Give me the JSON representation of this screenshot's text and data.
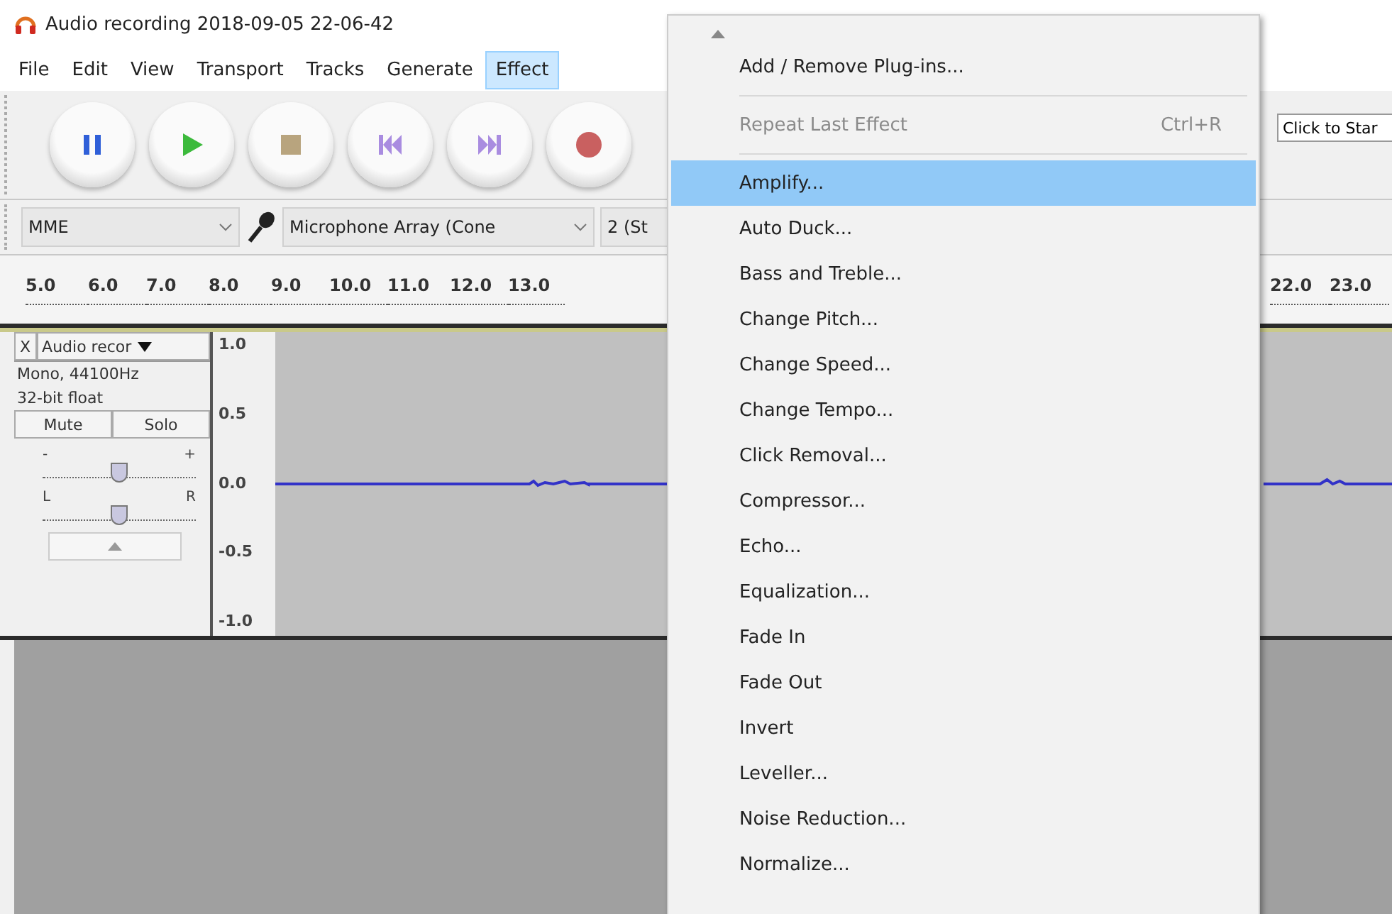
{
  "window": {
    "title": "Audio recording 2018-09-05 22-06-42"
  },
  "menu_bar": [
    {
      "label": "File",
      "selected": false
    },
    {
      "label": "Edit",
      "selected": false
    },
    {
      "label": "View",
      "selected": false
    },
    {
      "label": "Transport",
      "selected": false
    },
    {
      "label": "Tracks",
      "selected": false
    },
    {
      "label": "Generate",
      "selected": false
    },
    {
      "label": "Effect",
      "selected": true
    }
  ],
  "transport": [
    {
      "kind": "pause"
    },
    {
      "kind": "play"
    },
    {
      "kind": "stop"
    },
    {
      "kind": "skip_start"
    },
    {
      "kind": "skip_end"
    },
    {
      "kind": "record"
    }
  ],
  "device_toolbar": {
    "host": "MME",
    "input_device": "Microphone Array (Cone",
    "channels": "2 (St"
  },
  "ruler": {
    "left_labels": [
      "5.0",
      "6.0",
      "7.0",
      "8.0",
      "9.0",
      "10.0",
      "11.0",
      "12.0",
      "13.0"
    ],
    "right_labels": [
      "22.0",
      "23.0"
    ]
  },
  "selection_toolbar": {
    "button": "Click to Star"
  },
  "track": {
    "close": "X",
    "name": "Audio recor",
    "format": "Mono, 44100Hz",
    "sample_format": "32-bit float",
    "mute": "Mute",
    "solo": "Solo",
    "gain_minus": "-",
    "gain_plus": "+",
    "gain_slider": {
      "level": 0.5
    },
    "pan_left": "L",
    "pan_right": "R",
    "pan_slider": {
      "level": 0.5
    },
    "scale": [
      "1.0",
      "0.5",
      "0.0",
      "-0.5",
      "-1.0"
    ]
  },
  "effect_menu": [
    {
      "kind": "item",
      "label": "Add / Remove Plug-ins...",
      "disabled": false,
      "selected": false
    },
    {
      "kind": "separator"
    },
    {
      "kind": "item",
      "label": "Repeat Last Effect",
      "shortcut": "Ctrl+R",
      "disabled": true,
      "selected": false
    },
    {
      "kind": "separator"
    },
    {
      "kind": "item",
      "label": "Amplify...",
      "disabled": false,
      "selected": true
    },
    {
      "kind": "item",
      "label": "Auto Duck...",
      "disabled": false,
      "selected": false
    },
    {
      "kind": "item",
      "label": "Bass and Treble...",
      "disabled": false,
      "selected": false
    },
    {
      "kind": "item",
      "label": "Change Pitch...",
      "disabled": false,
      "selected": false
    },
    {
      "kind": "item",
      "label": "Change Speed...",
      "disabled": false,
      "selected": false
    },
    {
      "kind": "item",
      "label": "Change Tempo...",
      "disabled": false,
      "selected": false
    },
    {
      "kind": "item",
      "label": "Click Removal...",
      "disabled": false,
      "selected": false
    },
    {
      "kind": "item",
      "label": "Compressor...",
      "disabled": false,
      "selected": false
    },
    {
      "kind": "item",
      "label": "Echo...",
      "disabled": false,
      "selected": false
    },
    {
      "kind": "item",
      "label": "Equalization...",
      "disabled": false,
      "selected": false
    },
    {
      "kind": "item",
      "label": "Fade In",
      "disabled": false,
      "selected": false
    },
    {
      "kind": "item",
      "label": "Fade Out",
      "disabled": false,
      "selected": false
    },
    {
      "kind": "item",
      "label": "Invert",
      "disabled": false,
      "selected": false
    },
    {
      "kind": "item",
      "label": "Leveller...",
      "disabled": false,
      "selected": false
    },
    {
      "kind": "item",
      "label": "Noise Reduction...",
      "disabled": false,
      "selected": false
    },
    {
      "kind": "item",
      "label": "Normalize...",
      "disabled": false,
      "selected": false
    }
  ]
}
